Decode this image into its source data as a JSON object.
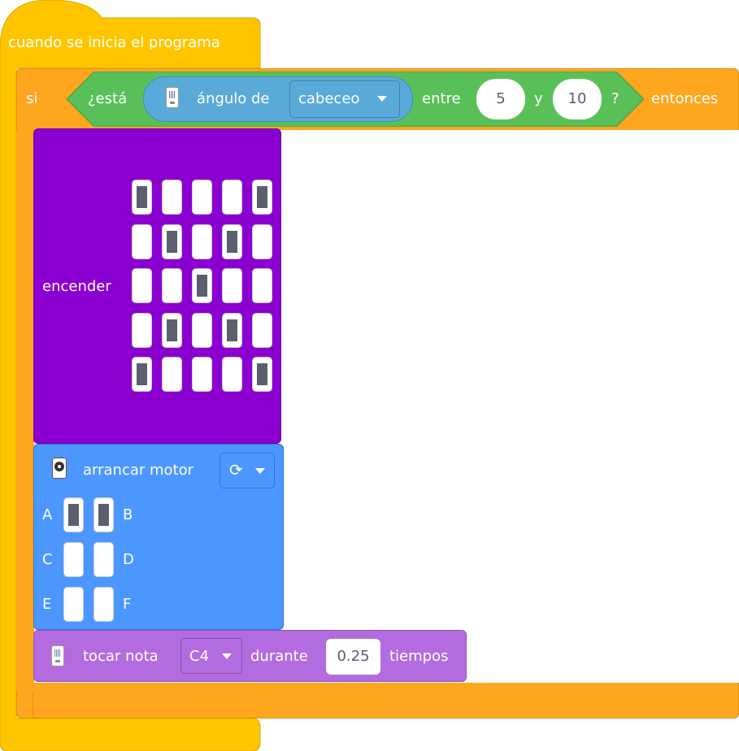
{
  "hat": {
    "label": "cuando se inicia el programa"
  },
  "if_block": {
    "si_label": "si",
    "entonces_label": "entonces"
  },
  "condition": {
    "prefix": "¿está",
    "sensor_label": "ángulo de",
    "sensor_dropdown": "cabeceo",
    "between_label": "entre",
    "low_value": "5",
    "and_label": "y",
    "high_value": "10",
    "question_mark": "?"
  },
  "led_block": {
    "label": "encender",
    "grid": [
      [
        1,
        0,
        0,
        0,
        1
      ],
      [
        0,
        1,
        0,
        1,
        0
      ],
      [
        0,
        0,
        1,
        0,
        0
      ],
      [
        0,
        1,
        0,
        1,
        0
      ],
      [
        1,
        0,
        0,
        0,
        1
      ]
    ]
  },
  "motor_block": {
    "label": "arrancar motor",
    "direction_icon": "clockwise-arrow-icon",
    "ports": [
      {
        "left": "A",
        "right": "B",
        "left_on": 1,
        "right_on": 1
      },
      {
        "left": "C",
        "right": "D",
        "left_on": 0,
        "right_on": 0
      },
      {
        "left": "E",
        "right": "F",
        "left_on": 0,
        "right_on": 0
      }
    ]
  },
  "tone_block": {
    "label": "tocar nota",
    "note": "C4",
    "duration_label": "durante",
    "duration": "0.25",
    "unit_label": "tiempos"
  },
  "colors": {
    "hat": "#ffc600",
    "control": "#fea71e",
    "operator": "#59c059",
    "sensor": "#59aad8",
    "led": "#8b00d1",
    "motor": "#4c97ff",
    "sound": "#b36be0"
  }
}
